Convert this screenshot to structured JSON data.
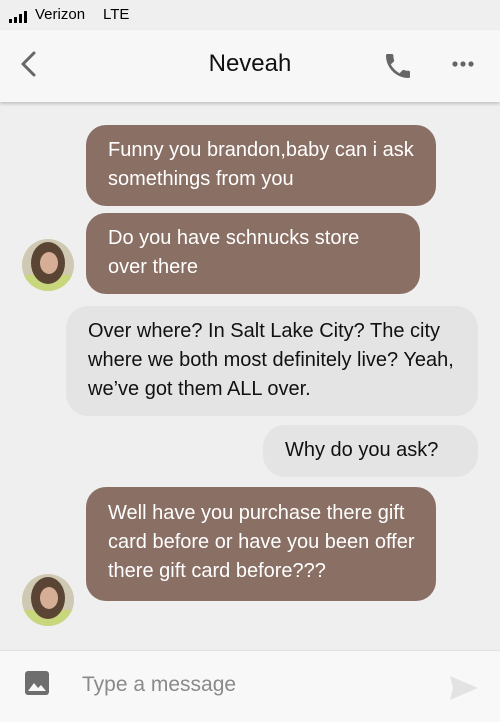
{
  "status_bar": {
    "carrier": "Verizon",
    "network": "LTE"
  },
  "header": {
    "back_icon": "chevron-left-icon",
    "contact_name": "Neveah",
    "call_icon": "phone-icon",
    "more_icon": "more-horizontal-icon"
  },
  "messages": [
    {
      "direction": "incoming",
      "text": "Funny you brandon,baby can i ask somethings from you"
    },
    {
      "direction": "incoming",
      "text": "Do you have schnucks store over there"
    },
    {
      "direction": "outgoing",
      "text": "Over where? In Salt Lake City? The city where we both most definitely live? Yeah, we’ve got them ALL over."
    },
    {
      "direction": "outgoing",
      "text": "Why do you ask?"
    },
    {
      "direction": "incoming",
      "text": "Well have you purchase there gift card before or have you been offer there gift card before???"
    }
  ],
  "composer": {
    "placeholder": "Type a message",
    "image_icon": "image-icon",
    "send_icon": "send-icon"
  },
  "colors": {
    "incoming_bubble": "#8a6f64",
    "outgoing_bubble": "#e4e4e4",
    "background": "#efefef"
  }
}
